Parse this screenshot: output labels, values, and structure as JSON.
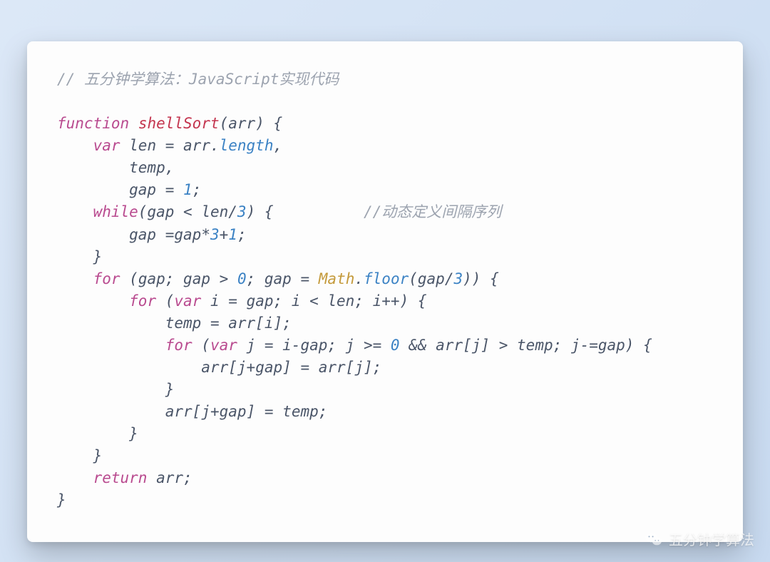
{
  "code": {
    "tokens": [
      [
        {
          "t": "// 五分钟学算法：JavaScript实现代码",
          "c": "comment"
        }
      ],
      [],
      [
        {
          "t": "function",
          "c": "keyword"
        },
        {
          "t": " ",
          "c": "ident"
        },
        {
          "t": "shellSort",
          "c": "func"
        },
        {
          "t": "(",
          "c": "paren"
        },
        {
          "t": "arr",
          "c": "ident"
        },
        {
          "t": ")",
          "c": "paren"
        },
        {
          "t": " {",
          "c": "punc"
        }
      ],
      [
        {
          "t": "    ",
          "c": "ident"
        },
        {
          "t": "var",
          "c": "keyword"
        },
        {
          "t": " len ",
          "c": "ident"
        },
        {
          "t": "=",
          "c": "op"
        },
        {
          "t": " arr",
          "c": "ident"
        },
        {
          "t": ".",
          "c": "punc"
        },
        {
          "t": "length",
          "c": "prop"
        },
        {
          "t": ",",
          "c": "punc"
        }
      ],
      [
        {
          "t": "        temp,",
          "c": "ident"
        }
      ],
      [
        {
          "t": "        gap ",
          "c": "ident"
        },
        {
          "t": "=",
          "c": "op"
        },
        {
          "t": " ",
          "c": "ident"
        },
        {
          "t": "1",
          "c": "num"
        },
        {
          "t": ";",
          "c": "punc"
        }
      ],
      [
        {
          "t": "    ",
          "c": "ident"
        },
        {
          "t": "while",
          "c": "keyword"
        },
        {
          "t": "(",
          "c": "paren"
        },
        {
          "t": "gap ",
          "c": "ident"
        },
        {
          "t": "<",
          "c": "op"
        },
        {
          "t": " len",
          "c": "ident"
        },
        {
          "t": "/",
          "c": "op"
        },
        {
          "t": "3",
          "c": "num"
        },
        {
          "t": ")",
          "c": "paren"
        },
        {
          "t": " {          ",
          "c": "punc"
        },
        {
          "t": "//动态定义间隔序列",
          "c": "comment"
        }
      ],
      [
        {
          "t": "        gap ",
          "c": "ident"
        },
        {
          "t": "=",
          "c": "op"
        },
        {
          "t": "gap",
          "c": "ident"
        },
        {
          "t": "*",
          "c": "op"
        },
        {
          "t": "3",
          "c": "num"
        },
        {
          "t": "+",
          "c": "op"
        },
        {
          "t": "1",
          "c": "num"
        },
        {
          "t": ";",
          "c": "punc"
        }
      ],
      [
        {
          "t": "    }",
          "c": "punc"
        }
      ],
      [
        {
          "t": "    ",
          "c": "ident"
        },
        {
          "t": "for",
          "c": "keyword"
        },
        {
          "t": " (",
          "c": "paren"
        },
        {
          "t": "gap",
          "c": "ident"
        },
        {
          "t": "; ",
          "c": "punc"
        },
        {
          "t": "gap ",
          "c": "ident"
        },
        {
          "t": ">",
          "c": "op"
        },
        {
          "t": " ",
          "c": "ident"
        },
        {
          "t": "0",
          "c": "num"
        },
        {
          "t": "; ",
          "c": "punc"
        },
        {
          "t": "gap ",
          "c": "ident"
        },
        {
          "t": "=",
          "c": "op"
        },
        {
          "t": " ",
          "c": "ident"
        },
        {
          "t": "Math",
          "c": "class"
        },
        {
          "t": ".",
          "c": "punc"
        },
        {
          "t": "floor",
          "c": "prop"
        },
        {
          "t": "(",
          "c": "paren"
        },
        {
          "t": "gap",
          "c": "ident"
        },
        {
          "t": "/",
          "c": "op"
        },
        {
          "t": "3",
          "c": "num"
        },
        {
          "t": "))",
          "c": "paren"
        },
        {
          "t": " {",
          "c": "punc"
        }
      ],
      [
        {
          "t": "        ",
          "c": "ident"
        },
        {
          "t": "for",
          "c": "keyword"
        },
        {
          "t": " (",
          "c": "paren"
        },
        {
          "t": "var",
          "c": "keyword"
        },
        {
          "t": " i ",
          "c": "ident"
        },
        {
          "t": "=",
          "c": "op"
        },
        {
          "t": " gap",
          "c": "ident"
        },
        {
          "t": "; ",
          "c": "punc"
        },
        {
          "t": "i ",
          "c": "ident"
        },
        {
          "t": "<",
          "c": "op"
        },
        {
          "t": " len",
          "c": "ident"
        },
        {
          "t": "; ",
          "c": "punc"
        },
        {
          "t": "i",
          "c": "ident"
        },
        {
          "t": "++",
          "c": "op"
        },
        {
          "t": ")",
          "c": "paren"
        },
        {
          "t": " {",
          "c": "punc"
        }
      ],
      [
        {
          "t": "            temp ",
          "c": "ident"
        },
        {
          "t": "=",
          "c": "op"
        },
        {
          "t": " arr",
          "c": "ident"
        },
        {
          "t": "[",
          "c": "punc"
        },
        {
          "t": "i",
          "c": "ident"
        },
        {
          "t": "]",
          "c": "punc"
        },
        {
          "t": ";",
          "c": "punc"
        }
      ],
      [
        {
          "t": "            ",
          "c": "ident"
        },
        {
          "t": "for",
          "c": "keyword"
        },
        {
          "t": " (",
          "c": "paren"
        },
        {
          "t": "var",
          "c": "keyword"
        },
        {
          "t": " j ",
          "c": "ident"
        },
        {
          "t": "=",
          "c": "op"
        },
        {
          "t": " i",
          "c": "ident"
        },
        {
          "t": "-",
          "c": "op"
        },
        {
          "t": "gap",
          "c": "ident"
        },
        {
          "t": "; ",
          "c": "punc"
        },
        {
          "t": "j ",
          "c": "ident"
        },
        {
          "t": ">=",
          "c": "op"
        },
        {
          "t": " ",
          "c": "ident"
        },
        {
          "t": "0",
          "c": "num"
        },
        {
          "t": " ",
          "c": "ident"
        },
        {
          "t": "&&",
          "c": "op"
        },
        {
          "t": " arr",
          "c": "ident"
        },
        {
          "t": "[",
          "c": "punc"
        },
        {
          "t": "j",
          "c": "ident"
        },
        {
          "t": "]",
          "c": "punc"
        },
        {
          "t": " ",
          "c": "ident"
        },
        {
          "t": ">",
          "c": "op"
        },
        {
          "t": " temp",
          "c": "ident"
        },
        {
          "t": "; ",
          "c": "punc"
        },
        {
          "t": "j",
          "c": "ident"
        },
        {
          "t": "-=",
          "c": "op"
        },
        {
          "t": "gap",
          "c": "ident"
        },
        {
          "t": ")",
          "c": "paren"
        },
        {
          "t": " {",
          "c": "punc"
        }
      ],
      [
        {
          "t": "                arr",
          "c": "ident"
        },
        {
          "t": "[",
          "c": "punc"
        },
        {
          "t": "j",
          "c": "ident"
        },
        {
          "t": "+",
          "c": "op"
        },
        {
          "t": "gap",
          "c": "ident"
        },
        {
          "t": "]",
          "c": "punc"
        },
        {
          "t": " ",
          "c": "ident"
        },
        {
          "t": "=",
          "c": "op"
        },
        {
          "t": " arr",
          "c": "ident"
        },
        {
          "t": "[",
          "c": "punc"
        },
        {
          "t": "j",
          "c": "ident"
        },
        {
          "t": "]",
          "c": "punc"
        },
        {
          "t": ";",
          "c": "punc"
        }
      ],
      [
        {
          "t": "            }",
          "c": "punc"
        }
      ],
      [
        {
          "t": "            arr",
          "c": "ident"
        },
        {
          "t": "[",
          "c": "punc"
        },
        {
          "t": "j",
          "c": "ident"
        },
        {
          "t": "+",
          "c": "op"
        },
        {
          "t": "gap",
          "c": "ident"
        },
        {
          "t": "]",
          "c": "punc"
        },
        {
          "t": " ",
          "c": "ident"
        },
        {
          "t": "=",
          "c": "op"
        },
        {
          "t": " temp",
          "c": "ident"
        },
        {
          "t": ";",
          "c": "punc"
        }
      ],
      [
        {
          "t": "        }",
          "c": "punc"
        }
      ],
      [
        {
          "t": "    }",
          "c": "punc"
        }
      ],
      [
        {
          "t": "    ",
          "c": "ident"
        },
        {
          "t": "return",
          "c": "keyword"
        },
        {
          "t": " arr",
          "c": "ident"
        },
        {
          "t": ";",
          "c": "punc"
        }
      ],
      [
        {
          "t": "}",
          "c": "punc"
        }
      ]
    ]
  },
  "watermark": {
    "text": "五分钟学算法"
  }
}
